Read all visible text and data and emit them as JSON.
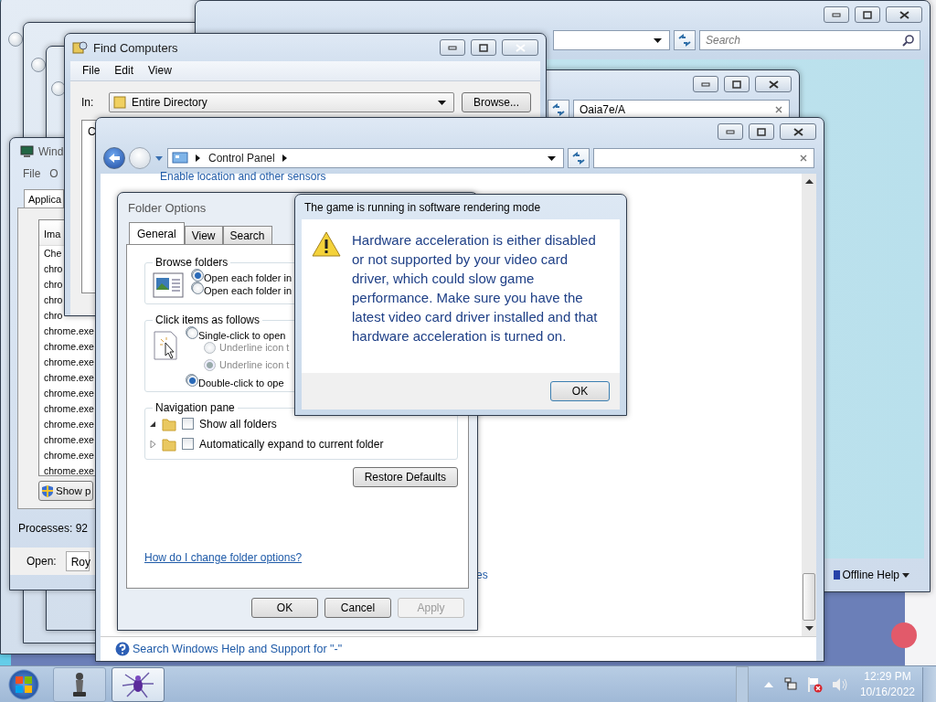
{
  "explorer": {
    "search": {
      "placeholder": "Search"
    },
    "help_button": "Offline Help"
  },
  "search_window": {
    "search_value": "Oaia7e/A"
  },
  "task_manager": {
    "title": "Wind",
    "menu": [
      "File",
      "O"
    ],
    "tabs": [
      {
        "label": "Applica",
        "selected": true
      }
    ],
    "column": "Ima",
    "rows": [
      "Che",
      "chro",
      "chro",
      "chro",
      "chro",
      "chrome.exe",
      "chrome.exe",
      "chrome.exe",
      "chrome.exe",
      "chrome.exe",
      "chrome.exe",
      "chrome.exe",
      "chrome.exe",
      "chrome.exe",
      "chrome.exe"
    ],
    "button": "Show p",
    "status": "Processes: 92",
    "open_label": "Open:",
    "open_value": "Roy"
  },
  "find_computers": {
    "title": "Find Computers",
    "menu": [
      "File",
      "Edit",
      "View"
    ],
    "in_label": "In:",
    "scope": "Entire Directory",
    "browse_button": "Browse...",
    "results": [
      "C"
    ]
  },
  "control_panel": {
    "breadcrumb": "Control Panel",
    "link": "Enable location and other sensors",
    "fragment": "es",
    "help_link": "Search Windows Help and Support for \"-\""
  },
  "folder_options": {
    "title": "Folder Options",
    "tabs": [
      {
        "label": "General",
        "selected": true
      },
      {
        "label": "View",
        "selected": false
      },
      {
        "label": "Search",
        "selected": false
      }
    ],
    "groups": [
      {
        "title": "Browse folders",
        "options": [
          {
            "kind": "radio",
            "label": "Open each folder in",
            "checked": true,
            "disabled": false
          },
          {
            "kind": "radio",
            "label": "Open each folder in",
            "checked": false,
            "disabled": false
          }
        ]
      },
      {
        "title": "Click items as follows",
        "options": [
          {
            "kind": "radio",
            "label": "Single-click to open",
            "checked": false,
            "disabled": false
          },
          {
            "kind": "subradio",
            "label": "Underline icon t",
            "checked": false,
            "disabled": true
          },
          {
            "kind": "subradio",
            "label": "Underline icon t",
            "checked": true,
            "disabled": true
          },
          {
            "kind": "radio",
            "label": "Double-click to ope",
            "checked": true,
            "disabled": false
          }
        ]
      },
      {
        "title": "Navigation pane",
        "options": [
          {
            "kind": "tree",
            "label": "Show all folders",
            "checked": false,
            "disabled": false,
            "expanded": true
          },
          {
            "kind": "tree",
            "label": "Automatically expand to current folder",
            "checked": false,
            "disabled": false,
            "expanded": false
          }
        ]
      }
    ],
    "restore_button": "Restore Defaults",
    "help_link": "How do I change folder options?",
    "buttons": [
      {
        "label": "OK",
        "disabled": false
      },
      {
        "label": "Cancel",
        "disabled": false
      },
      {
        "label": "Apply",
        "disabled": true
      }
    ]
  },
  "alert": {
    "title": "The game is running in software rendering mode",
    "message": "Hardware acceleration is either disabled or not supported by your video card driver, which could slow game performance. Make sure you have the latest video card driver installed and that hardware acceleration is turned on.",
    "button": "OK"
  },
  "taskbar": {
    "tasks": [
      {
        "kind": "chess",
        "selected": false
      },
      {
        "kind": "spider",
        "selected": true
      }
    ],
    "time": "12:29 PM",
    "date": "10/16/2022"
  }
}
